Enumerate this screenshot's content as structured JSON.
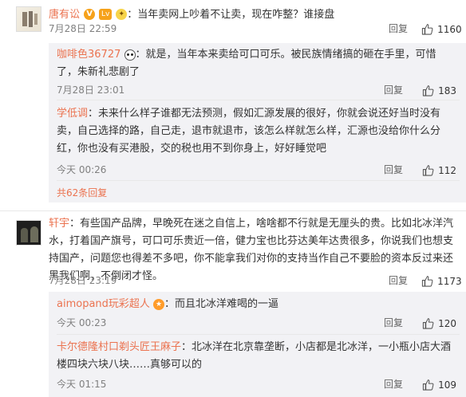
{
  "comments": [
    {
      "user": "唐有讼",
      "badges": [
        "V",
        "Lv",
        "emoji"
      ],
      "text": "：当年卖网上吵着不让卖，现在咋整？谁接盘",
      "time": "7月28日 22:59",
      "reply_label": "回复",
      "likes": "1160"
    },
    {
      "user": "轩宇",
      "text": "：有些国产品牌，早晚死在迷之自信上，啥啥都不行就是无厘头的贵。比如北冰洋汽水，打着国产旗号，可口可乐贵近一倍，健力宝也比芬达美年达贵很多，你说我们也想支持国产，问题您也得差不多吧，你不能拿我们对你的支持当作自己不要脸的资本反过来还黑我们啊，不倒闭才怪。",
      "time": "7月28日 23:19",
      "reply_label": "回复",
      "likes": "1173"
    }
  ],
  "replies": [
    {
      "user": "咖啡色36727",
      "text": "：就是，当年本来卖给可口可乐。被民族情绪搞的砸在手里，可惜了，朱新礼悲剧了",
      "time": "7月28日 23:01",
      "reply_label": "回复",
      "likes": "183"
    },
    {
      "user": "学低调",
      "text": "：未来什么样子谁都无法预测，假如汇源发展的很好，你就会说还好当时没有卖，自己选择的路，自己走，退市就退市，该怎么样就怎么样，汇源也没给你什么分红，你也没有买港股，交的税也用不到你身上，好好睡觉吧",
      "time": "今天 00:26",
      "reply_label": "回复",
      "likes": "112"
    },
    {
      "user": "aimopand玩彩超人",
      "text": "：而且北冰洋难喝的一逼",
      "time": "今天 00:23",
      "reply_label": "回复",
      "likes": "120"
    },
    {
      "user": "卡尔德隆村口剃头匠王麻子",
      "text": "：北冰洋在北京靠垄断，小店都是北冰洋，一小瓶小店大酒楼四块六块八块……真够可以的",
      "time": "今天 01:15",
      "reply_label": "回复",
      "likes": "109"
    }
  ],
  "more_replies": "共62条回复",
  "colors": {
    "username": "#eb7350",
    "reply_bg": "#f2f2f5",
    "muted": "#808080"
  },
  "icons": [
    "thumbs-up-icon",
    "vip-badge-icon",
    "panda-badge-icon",
    "star-badge-icon"
  ]
}
